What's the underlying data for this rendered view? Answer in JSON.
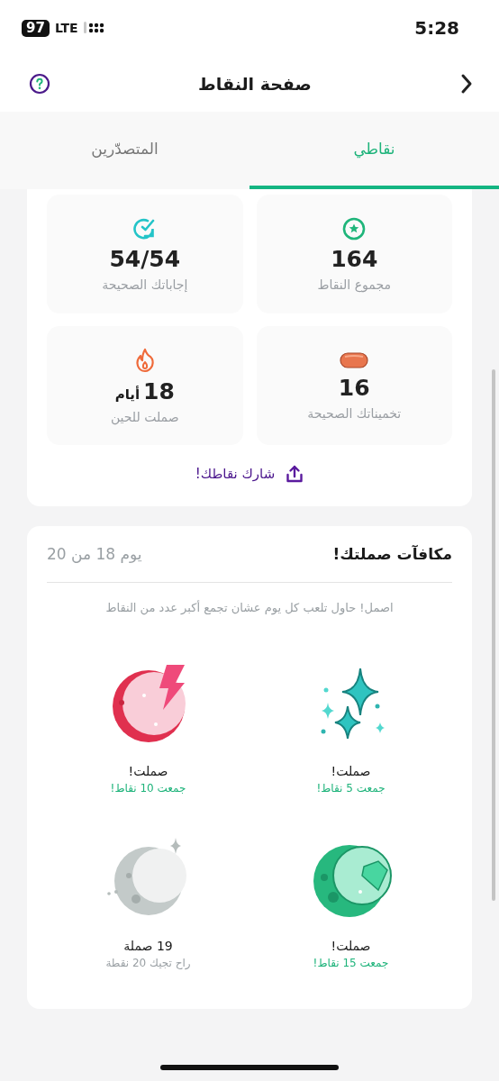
{
  "status_bar": {
    "time": "5:28",
    "battery": "97",
    "network": "LTE"
  },
  "header": {
    "title": "صفحة النقاط"
  },
  "tabs": [
    {
      "label": "نقاطي",
      "selected": true
    },
    {
      "label": "المتصدّرين",
      "selected": false
    }
  ],
  "stats": [
    {
      "value": "164",
      "label": "مجموع النقاط"
    },
    {
      "value": "54/54",
      "label": "إجاباتك الصحيحة"
    },
    {
      "value": "16",
      "label": "تخميناتك الصحيحة"
    },
    {
      "value": "18",
      "unit": "أيام",
      "label": "صملت للحين"
    }
  ],
  "share_link": "شارك نقاطك!",
  "streak_card": {
    "title": "مكافآت صملتك!",
    "progress": "يوم 18 من 20",
    "hint": "اصمل! حاول تلعب كل يوم عشان تجمع أكبر عدد من النقاط",
    "rewards": [
      {
        "title": "صملت!",
        "caption": "جمعت 5 نقاط!",
        "achieved": true
      },
      {
        "title": "صملت!",
        "caption": "جمعت 10 نقاط!",
        "achieved": true
      },
      {
        "title": "صملت!",
        "caption": "جمعت 15 نقاط!",
        "achieved": true
      },
      {
        "title": "19 صملة",
        "caption": "راح تجيك 20 نقطة",
        "achieved": false
      }
    ]
  }
}
